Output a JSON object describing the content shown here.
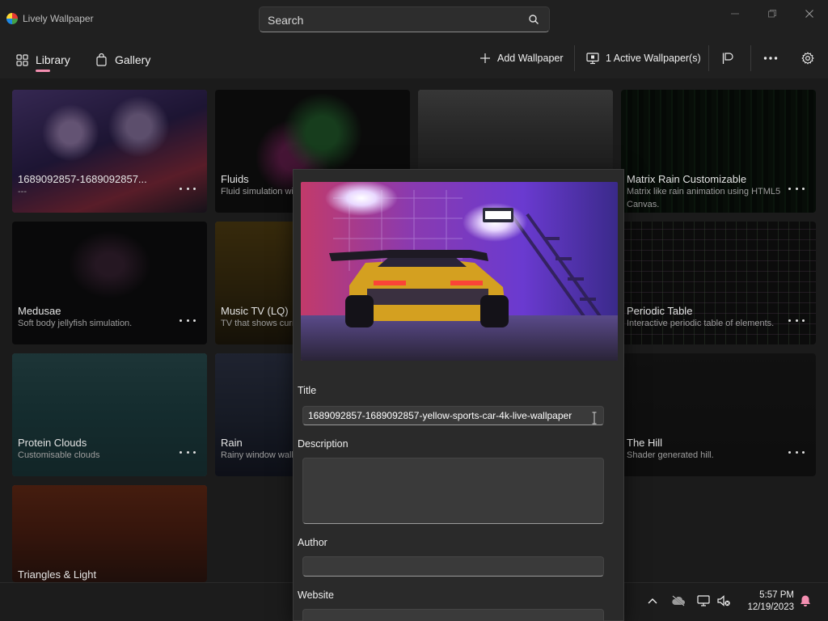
{
  "window": {
    "title": "Lively Wallpaper",
    "search_placeholder": "Search",
    "minimize_icon": "minimize-icon",
    "maximize_icon": "restore-icon",
    "close_icon": "close-icon"
  },
  "nav": {
    "library_label": "Library",
    "gallery_label": "Gallery",
    "add_wallpaper_label": "Add Wallpaper",
    "active_wallpapers_label": "1 Active Wallpaper(s)",
    "accent_color": "#f48fb1"
  },
  "library": [
    {
      "title": "1689092857-1689092857...",
      "description": "---"
    },
    {
      "title": "Fluids",
      "description": "Fluid simulation with system audio"
    },
    {
      "title": "",
      "description": ""
    },
    {
      "title": "Matrix Rain Customizable",
      "description": "Matrix like rain animation using HTML5 Canvas."
    },
    {
      "title": "Medusae",
      "description": "Soft body jellyfish simulation."
    },
    {
      "title": "Music TV (LQ)",
      "description": "TV that shows current music"
    },
    {
      "title": "",
      "description": ""
    },
    {
      "title": "Periodic Table",
      "description": "Interactive periodic table of elements."
    },
    {
      "title": "Protein Clouds",
      "description": "Customisable clouds"
    },
    {
      "title": "Rain",
      "description": "Rainy window wallpaper"
    },
    {
      "title": "",
      "description": ""
    },
    {
      "title": "The Hill",
      "description": "Shader generated hill."
    },
    {
      "title": "Triangles & Light",
      "description": ""
    }
  ],
  "details": {
    "title_label": "Title",
    "title_value": "1689092857-1689092857-yellow-sports-car-4k-live-wallpaper",
    "description_label": "Description",
    "description_value": "",
    "author_label": "Author",
    "author_value": "",
    "website_label": "Website",
    "website_value": ""
  },
  "taskbar": {
    "time": "5:57 PM",
    "date": "12/19/2023"
  }
}
